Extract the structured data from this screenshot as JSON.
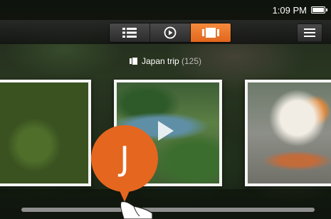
{
  "status_bar": {
    "time": "1:09 PM",
    "icons": [
      "battery-icon"
    ]
  },
  "toolbar": {
    "view_modes": [
      {
        "name": "list-view",
        "icon": "list-icon",
        "active": false
      },
      {
        "name": "play-slideshow",
        "icon": "play-circle-icon",
        "active": false
      },
      {
        "name": "filmstrip-view",
        "icon": "filmstrip-icon",
        "active": true
      }
    ],
    "menu_icon": "hamburger-menu-icon"
  },
  "album": {
    "title": "Japan trip",
    "count": "(125)",
    "icon": "album-icon"
  },
  "photos": [
    {
      "description": "moss-ball-plant",
      "is_video": false
    },
    {
      "description": "japanese-garden",
      "is_video": true
    },
    {
      "description": "cat-eating",
      "is_video": false
    }
  ],
  "scrubber": {
    "index_letter": "J",
    "position_fraction": 0.34
  },
  "colors": {
    "accent": "#e5661f",
    "toolbar": "#2b2b2b",
    "track": "#8e8e8e"
  }
}
